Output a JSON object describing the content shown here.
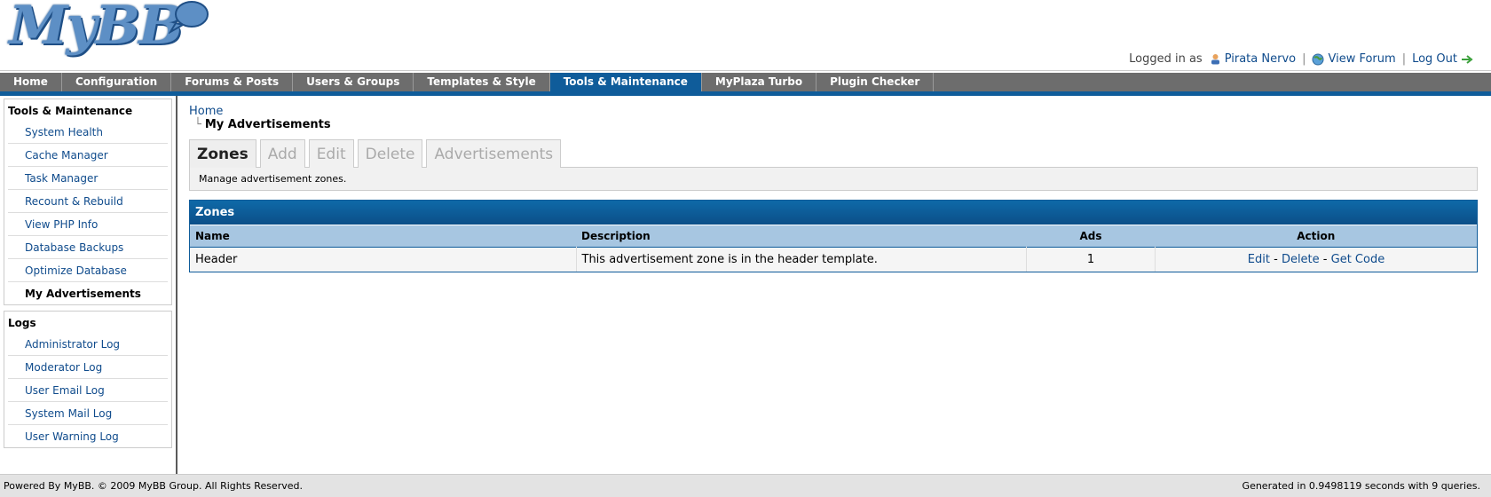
{
  "logo": {
    "text": "MyBB"
  },
  "user_bar": {
    "logged_in_label": "Logged in as",
    "username": "Pirata Nervo",
    "view_forum": "View Forum",
    "log_out": "Log Out",
    "separator": "|"
  },
  "menu": {
    "tabs": [
      {
        "label": "Home"
      },
      {
        "label": "Configuration"
      },
      {
        "label": "Forums & Posts"
      },
      {
        "label": "Users & Groups"
      },
      {
        "label": "Templates & Style"
      },
      {
        "label": "Tools & Maintenance",
        "active": true
      },
      {
        "label": "MyPlaza Turbo"
      },
      {
        "label": "Plugin Checker"
      }
    ]
  },
  "sidebar": {
    "tools": {
      "title": "Tools & Maintenance",
      "items": [
        "System Health",
        "Cache Manager",
        "Task Manager",
        "Recount & Rebuild",
        "View PHP Info",
        "Database Backups",
        "Optimize Database",
        "My Advertisements"
      ]
    },
    "logs": {
      "title": "Logs",
      "items": [
        "Administrator Log",
        "Moderator Log",
        "User Email Log",
        "System Mail Log",
        "User Warning Log"
      ]
    }
  },
  "breadcrumb": {
    "home": "Home",
    "current": "My Advertisements"
  },
  "tabs": {
    "items": [
      "Zones",
      "Add",
      "Edit",
      "Delete",
      "Advertisements"
    ],
    "description": "Manage advertisement zones."
  },
  "zones_table": {
    "title": "Zones",
    "headers": {
      "name": "Name",
      "description": "Description",
      "ads": "Ads",
      "action": "Action"
    },
    "rows": [
      {
        "name": "Header",
        "description": "This advertisement zone is in the header template.",
        "ads": "1",
        "edit": "Edit",
        "delete": "Delete",
        "get_code": "Get Code"
      }
    ]
  },
  "footer": {
    "left": "Powered By MyBB. © 2009 MyBB Group. All Rights Reserved.",
    "right": "Generated in 0.9498119 seconds with 9 queries."
  },
  "colors": {
    "accent": "#0f5c9a",
    "menu_bg": "#6d6d6d",
    "link": "#0f4b8c",
    "header_row": "#a7c6e1"
  }
}
